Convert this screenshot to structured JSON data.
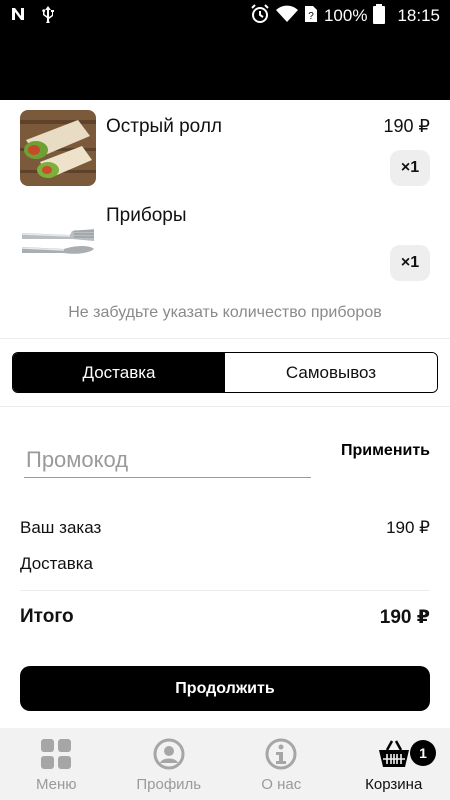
{
  "status_bar": {
    "left_icons": [
      "n-icon",
      "usb-icon"
    ],
    "battery": "100%",
    "time": "18:15"
  },
  "cart": {
    "items": [
      {
        "name": "Острый ролл",
        "price": "190 ₽",
        "qty": "×1",
        "image": "roll-image"
      },
      {
        "name": "Приборы",
        "price": "",
        "qty": "×1",
        "image": "cutlery-image"
      }
    ],
    "cutlery_hint": "Не забудьте указать количество приборов"
  },
  "delivery": {
    "options": [
      "Доставка",
      "Самовывоз"
    ],
    "selected": "Доставка"
  },
  "promo": {
    "placeholder": "Промокод",
    "apply_label": "Применить"
  },
  "summary": {
    "order_label": "Ваш заказ",
    "order_value": "190 ₽",
    "delivery_label": "Доставка",
    "delivery_value": "",
    "total_label": "Итого",
    "total_value": "190 ₽"
  },
  "cta_label": "Продолжить",
  "tabbar": {
    "tabs": [
      {
        "label": "Меню",
        "icon": "grid-icon"
      },
      {
        "label": "Профиль",
        "icon": "profile-icon"
      },
      {
        "label": "О нас",
        "icon": "info-icon"
      },
      {
        "label": "Корзина",
        "icon": "basket-icon"
      }
    ],
    "active": "Корзина",
    "cart_badge": "1"
  },
  "colors": {
    "primary": "#000000",
    "muted_text": "#8a8a8a",
    "qty_bg": "#eeeeee",
    "tabbar_bg": "#f2f2f2"
  }
}
